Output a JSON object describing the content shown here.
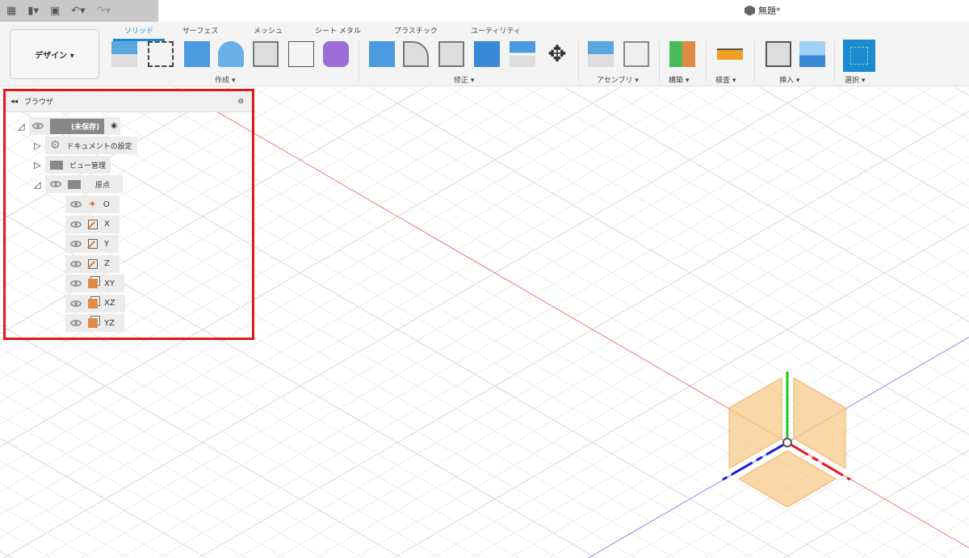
{
  "window_title": "無題*",
  "qat": {
    "grid": "grid-icon",
    "file": "file-icon",
    "save": "save-icon",
    "undo": "undo-icon",
    "redo": "redo-icon"
  },
  "workspace": "デザイン ▾",
  "tabs": [
    "ソリッド",
    "サーフェス",
    "メッシュ",
    "シート メタル",
    "プラスチック",
    "ユーティリティ"
  ],
  "groups": [
    "作成 ▾",
    "修正 ▾",
    "アセンブリ ▾",
    "構築 ▾",
    "検査 ▾",
    "挿入 ▾",
    "選択 ▾"
  ],
  "browser": {
    "title": "ブラウザ",
    "root": "(未保存)",
    "items": [
      "ドキュメントの設定",
      "ビュー管理",
      "原点"
    ],
    "origin_items": [
      "O",
      "X",
      "Y",
      "Z",
      "XY",
      "XZ",
      "YZ"
    ]
  },
  "colors": {
    "accent": "#1b8ad3",
    "highlight": "#e8141a",
    "x_axis": "#e8141a",
    "y_axis": "#1ec81e",
    "z_axis": "#1a1ae0",
    "plane": "#f7c98a"
  }
}
